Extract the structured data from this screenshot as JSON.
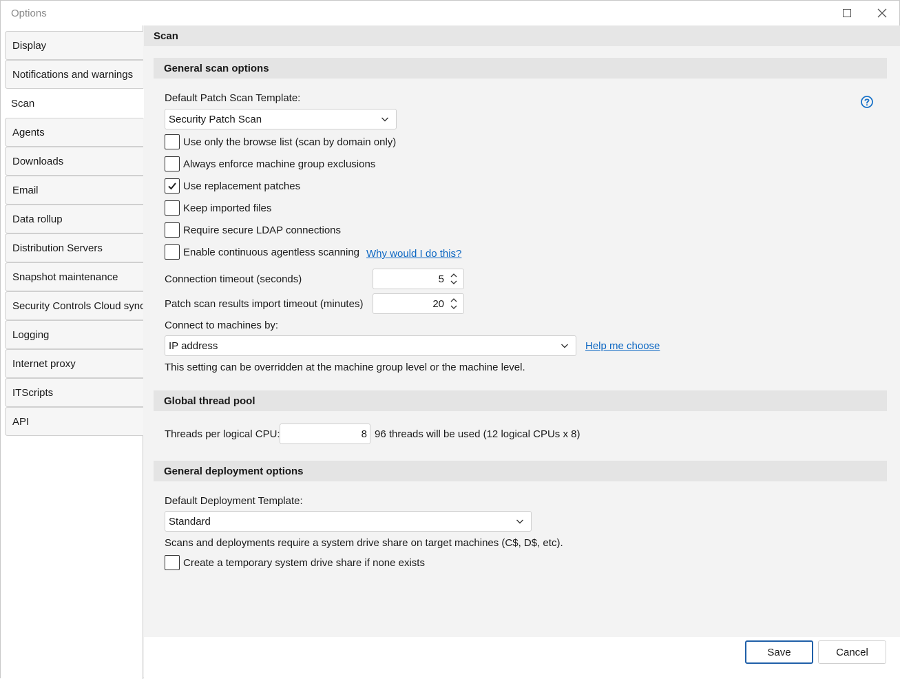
{
  "window": {
    "title": "Options"
  },
  "nav": {
    "items": [
      {
        "label": "Display"
      },
      {
        "label": "Notifications and warnings"
      },
      {
        "label": "Scan"
      },
      {
        "label": "Agents"
      },
      {
        "label": "Downloads"
      },
      {
        "label": "Email"
      },
      {
        "label": "Data rollup"
      },
      {
        "label": "Distribution Servers"
      },
      {
        "label": "Snapshot maintenance"
      },
      {
        "label": "Security Controls Cloud sync"
      },
      {
        "label": "Logging"
      },
      {
        "label": "Internet proxy"
      },
      {
        "label": "ITScripts"
      },
      {
        "label": "API"
      }
    ],
    "active_index": 2
  },
  "page": {
    "title": "Scan"
  },
  "general_scan": {
    "header": "General scan options",
    "template_label": "Default Patch Scan Template:",
    "template_value": "Security Patch Scan",
    "checkboxes": [
      {
        "label": "Use only the browse list (scan by domain only)",
        "checked": false
      },
      {
        "label": "Always enforce machine group exclusions",
        "checked": false
      },
      {
        "label": "Use replacement patches",
        "checked": true
      },
      {
        "label": "Keep imported files",
        "checked": false
      },
      {
        "label": "Require secure LDAP connections",
        "checked": false
      },
      {
        "label": "Enable continuous agentless scanning",
        "checked": false
      }
    ],
    "why_link": "Why would I do this?",
    "connection_timeout_label": "Connection timeout (seconds)",
    "connection_timeout_value": "5",
    "import_timeout_label": "Patch scan results import timeout (minutes)",
    "import_timeout_value": "20",
    "connect_by_label": "Connect to machines by:",
    "connect_by_value": "IP address",
    "help_choose_link": "Help me choose",
    "override_note": "This setting can be overridden at the machine group level or the machine level."
  },
  "thread_pool": {
    "header": "Global thread pool",
    "threads_label": "Threads per logical CPU:",
    "threads_value": "8",
    "threads_note": "96 threads will be used (12 logical CPUs x 8)"
  },
  "deployment": {
    "header": "General deployment options",
    "template_label": "Default Deployment Template:",
    "template_value": "Standard",
    "share_note": "Scans and deployments require a system drive share on target machines (C$, D$, etc).",
    "temp_share_label": "Create a temporary system drive share if none exists",
    "temp_share_checked": false
  },
  "footer": {
    "save_label": "Save",
    "cancel_label": "Cancel"
  },
  "colors": {
    "link": "#0b66c2",
    "primary_border": "#1f5fa8",
    "help_icon": "#1a73c9"
  }
}
